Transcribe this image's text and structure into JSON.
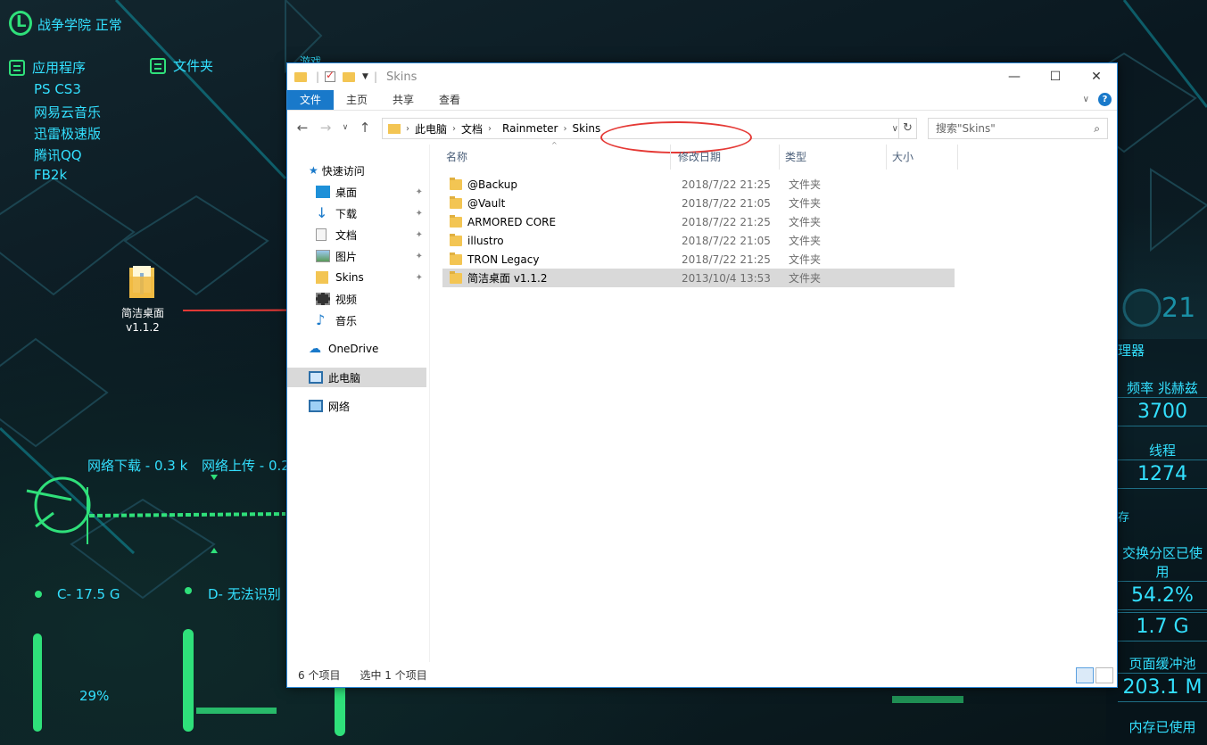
{
  "desktop": {
    "top_title": "战争学院 正常",
    "apps_header": "应用程序",
    "apps": [
      "PS CS3",
      "网易云音乐",
      "迅雷极速版",
      "腾讯QQ",
      "FB2k"
    ],
    "folder_header": "文件夹",
    "games_header": "游戏",
    "folder_icon_label": "简洁桌面\nv1.1.2",
    "net_down": "网络下载 - 0.3 k",
    "net_up": "网络上传 - 0.2",
    "drive_c": "C- 17.5 G",
    "drive_d": "D- 无法识别",
    "percent": "29%",
    "right_widget": {
      "clock_partial": "21",
      "processor_partial": "理器",
      "freq_label": "频率 兆赫兹",
      "freq_value": "3700",
      "threads_label": "线程",
      "threads_value": "1274",
      "mem_partial": "存",
      "swap_label": "交换分区已使用",
      "swap_value": "54.2%",
      "mem_size": "1.7 G",
      "page_pool_label": "页面缓冲池",
      "page_pool_value": "203.1 M",
      "mem_used_label": "内存已使用"
    }
  },
  "window": {
    "title": "Skins",
    "ribbon_tabs": [
      "文件",
      "主页",
      "共享",
      "查看"
    ],
    "help": "?",
    "breadcrumb": [
      "此电脑",
      "文档",
      "Rainmeter",
      "Skins"
    ],
    "search_placeholder": "搜索\"Skins\"",
    "nav": {
      "quick_access": "快速访问",
      "items": [
        "桌面",
        "下载",
        "文档",
        "图片",
        "Skins",
        "视频",
        "音乐"
      ],
      "onedrive": "OneDrive",
      "this_pc": "此电脑",
      "network": "网络"
    },
    "columns": [
      "名称",
      "修改日期",
      "类型",
      "大小"
    ],
    "files": [
      {
        "name": "@Backup",
        "date": "2018/7/22 21:25",
        "type": "文件夹"
      },
      {
        "name": "@Vault",
        "date": "2018/7/22 21:05",
        "type": "文件夹"
      },
      {
        "name": "ARMORED CORE",
        "date": "2018/7/22 21:25",
        "type": "文件夹"
      },
      {
        "name": "illustro",
        "date": "2018/7/22 21:05",
        "type": "文件夹"
      },
      {
        "name": "TRON Legacy",
        "date": "2018/7/22 21:25",
        "type": "文件夹"
      },
      {
        "name": "简洁桌面 v1.1.2",
        "date": "2013/10/4 13:53",
        "type": "文件夹"
      }
    ],
    "status_count": "6 个项目",
    "status_selected": "选中 1 个项目"
  },
  "colors": {
    "accent": "#1979ca",
    "desktop_text": "#33e0ff",
    "desktop_green": "#2fe07a",
    "highlight": "#e53935"
  }
}
